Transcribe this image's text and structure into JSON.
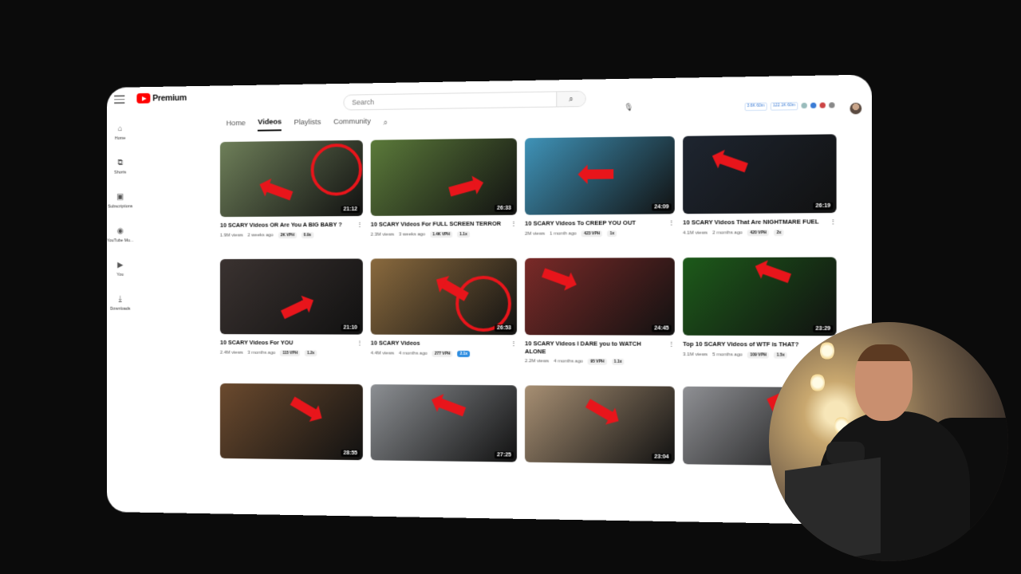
{
  "logo": {
    "text": "Premium"
  },
  "search": {
    "placeholder": "Search"
  },
  "extensions": {
    "badge1": "3.6K\n60m",
    "badge2": "122.1K\n60m"
  },
  "sidebar": {
    "items": [
      {
        "label": "Home",
        "icon": "home-icon",
        "glyph": "⌂"
      },
      {
        "label": "Shorts",
        "icon": "shorts-icon",
        "glyph": "⧉"
      },
      {
        "label": "Subscriptions",
        "icon": "subscriptions-icon",
        "glyph": "▣"
      },
      {
        "label": "YouTube Mu...",
        "icon": "youtube-music-icon",
        "glyph": "◉"
      },
      {
        "label": "You",
        "icon": "you-icon",
        "glyph": "▶"
      },
      {
        "label": "Downloads",
        "icon": "downloads-icon",
        "glyph": "⤓"
      }
    ]
  },
  "tabs": [
    {
      "label": "Home"
    },
    {
      "label": "Videos",
      "active": true
    },
    {
      "label": "Playlists"
    },
    {
      "label": "Community"
    }
  ],
  "videos": [
    {
      "title": "10 SCARY Videos OR Are You A BIG BABY ?",
      "duration": "21:12",
      "views": "1.9M views",
      "age": "2 weeks ago",
      "vph": "2K VPH",
      "ratio": "0.9x",
      "thumb_bg": "#6e7f59",
      "ratio_highlight": false
    },
    {
      "title": "10 SCARY Videos For FULL SCREEN TERROR",
      "duration": "26:33",
      "views": "2.3M views",
      "age": "3 weeks ago",
      "vph": "1.4K VPH",
      "ratio": "1.1x",
      "thumb_bg": "#5b7a3a",
      "ratio_highlight": false
    },
    {
      "title": "10 SCARY Videos To CREEP YOU OUT",
      "duration": "24:09",
      "views": "2M views",
      "age": "1 month ago",
      "vph": "423 VPH",
      "ratio": "1x",
      "thumb_bg": "#3f93b8",
      "ratio_highlight": false
    },
    {
      "title": "10 SCARY Videos That Are NIGHTMARE FUEL",
      "duration": "26:19",
      "views": "4.1M views",
      "age": "2 months ago",
      "vph": "420 VPH",
      "ratio": "2x",
      "thumb_bg": "#1e2530",
      "ratio_highlight": false
    },
    {
      "title": "10 SCARY Videos For YOU",
      "duration": "21:10",
      "views": "2.4M views",
      "age": "3 months ago",
      "vph": "115 VPH",
      "ratio": "1.2x",
      "thumb_bg": "#3a3230",
      "ratio_highlight": false
    },
    {
      "title": "10 SCARY Videos",
      "duration": "26:53",
      "views": "4.4M views",
      "age": "4 months ago",
      "vph": "277 VPH",
      "ratio": "2.1x",
      "thumb_bg": "#8a6a3e",
      "ratio_highlight": true
    },
    {
      "title": "10 SCARY Videos I DARE you to WATCH ALONE",
      "duration": "24:45",
      "views": "2.2M views",
      "age": "4 months ago",
      "vph": "95 VPH",
      "ratio": "1.1x",
      "thumb_bg": "#7a2a28",
      "ratio_highlight": false
    },
    {
      "title": "Top 10 SCARY Videos of WTF is THAT?",
      "duration": "23:29",
      "views": "3.1M views",
      "age": "5 months ago",
      "vph": "109 VPH",
      "ratio": "1.5x",
      "thumb_bg": "#1d5a1a",
      "ratio_highlight": false
    },
    {
      "title": "",
      "duration": "28:55",
      "thumb_bg": "#6b4a2e"
    },
    {
      "title": "",
      "duration": "27:25",
      "thumb_bg": "#8c8f93"
    },
    {
      "title": "",
      "duration": "23:04",
      "thumb_bg": "#a78f73"
    },
    {
      "title": "",
      "duration": "",
      "thumb_bg": "#8f9094"
    }
  ]
}
